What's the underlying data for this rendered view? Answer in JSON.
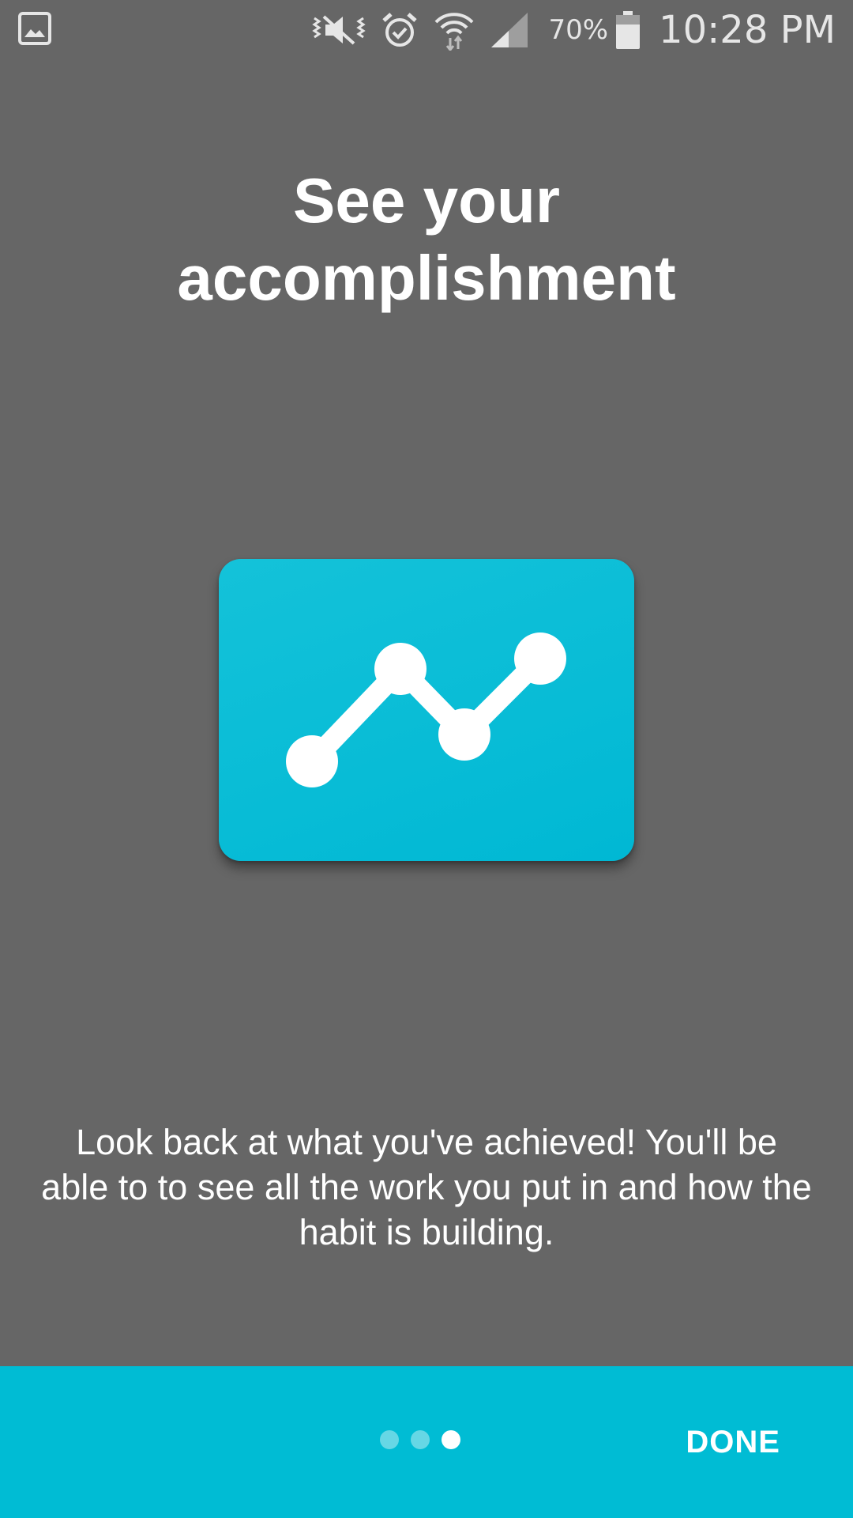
{
  "status_bar": {
    "left_icon": "image-icon",
    "icons": [
      "vibrate-icon",
      "alarm-icon",
      "wifi-icon",
      "signal-icon",
      "battery-icon"
    ],
    "battery_percent": "70%",
    "time": "10:28 PM"
  },
  "onboarding": {
    "title_line1": "See your",
    "title_line2": "accomplishment",
    "hero_icon": "line-chart-icon",
    "description": "Look back at what you've achieved! You'll be able to to see all the work you put in and how the habit is building."
  },
  "footer": {
    "page_count": 3,
    "current_page": 3,
    "done_label": "DONE"
  },
  "colors": {
    "background": "#666666",
    "accent": "#00bcd4",
    "text": "#ffffff"
  }
}
